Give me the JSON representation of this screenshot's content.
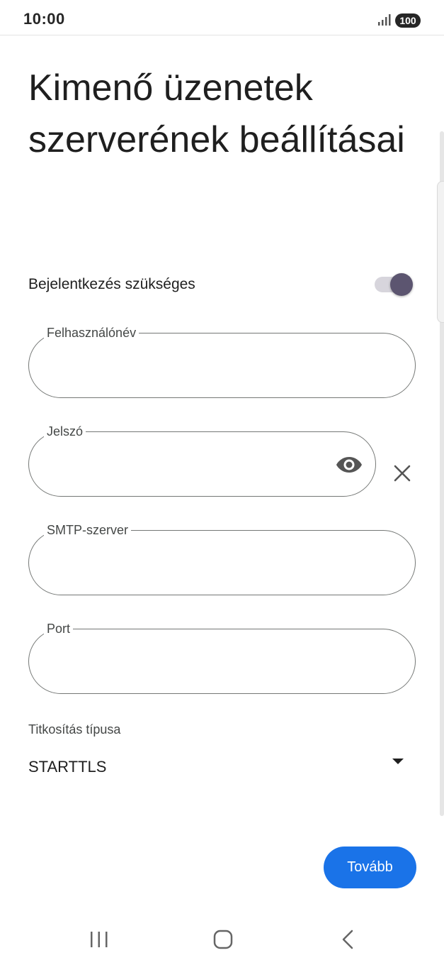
{
  "status_bar": {
    "time": "10:00",
    "battery": "100",
    "signal_icon": "signal-bars-icon"
  },
  "page": {
    "title": "Kimenő üzenetek szerverének beállításai"
  },
  "login_required": {
    "label": "Bejelentkezés szükséges",
    "enabled": true
  },
  "fields": {
    "username": {
      "label": "Felhasználónév",
      "value": ""
    },
    "password": {
      "label": "Jelszó",
      "value": "",
      "show_icon": "eye-icon",
      "clear_icon": "close-icon"
    },
    "smtp_server": {
      "label": "SMTP-szerver",
      "value": ""
    },
    "port": {
      "label": "Port",
      "value": ""
    }
  },
  "encryption": {
    "label": "Titkosítás típusa",
    "selected": "STARTTLS",
    "icon": "dropdown-arrow-icon"
  },
  "actions": {
    "next_label": "Tovább"
  },
  "nav_bar": {
    "recents_icon": "recents-icon",
    "home_icon": "home-icon",
    "back_icon": "back-icon"
  },
  "colors": {
    "accent": "#1a73e8",
    "toggle_thumb": "#5c5570",
    "toggle_track": "#d7d5dc",
    "outline": "#747775"
  }
}
